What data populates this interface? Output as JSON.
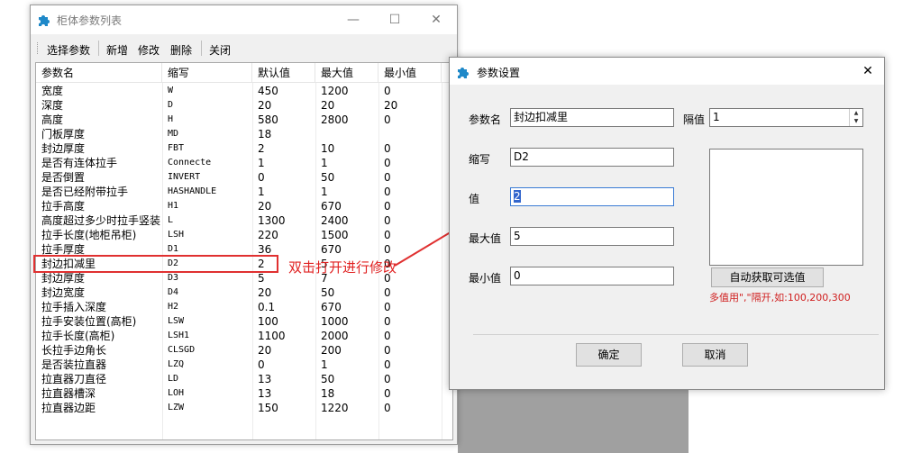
{
  "main_window": {
    "title": "柜体参数列表",
    "controls": {
      "minimize": "—",
      "maximize": "☐",
      "close": "✕"
    },
    "toolbar": [
      "选择参数",
      "新增",
      "修改",
      "删除",
      "关闭"
    ],
    "columns": [
      "参数名",
      "缩写",
      "默认值",
      "最大值",
      "最小值"
    ],
    "rows": [
      [
        "宽度",
        "W",
        "450",
        "1200",
        "0"
      ],
      [
        "深度",
        "D",
        "20",
        "20",
        "20"
      ],
      [
        "高度",
        "H",
        "580",
        "2800",
        "0"
      ],
      [
        "门板厚度",
        "MD",
        "18",
        "",
        ""
      ],
      [
        "封边厚度",
        "FBT",
        "2",
        "10",
        "0"
      ],
      [
        "是否有连体拉手",
        "Connecte",
        "1",
        "1",
        "0"
      ],
      [
        "是否倒置",
        "INVERT",
        "0",
        "50",
        "0"
      ],
      [
        "是否已经附带拉手",
        "HASHANDLE",
        "1",
        "1",
        "0"
      ],
      [
        "拉手高度",
        "H1",
        "20",
        "670",
        "0"
      ],
      [
        "高度超过多少时拉手竖装",
        "L",
        "1300",
        "2400",
        "0"
      ],
      [
        "拉手长度(地柜吊柜)",
        "LSH",
        "220",
        "1500",
        "0"
      ],
      [
        "拉手厚度",
        "D1",
        "36",
        "670",
        "0"
      ],
      [
        "封边扣减里",
        "D2",
        "2",
        "5",
        "0"
      ],
      [
        "封边厚度",
        "D3",
        "5",
        "7",
        "0"
      ],
      [
        "封边宽度",
        "D4",
        "20",
        "50",
        "0"
      ],
      [
        "拉手插入深度",
        "H2",
        "0.1",
        "670",
        "0"
      ],
      [
        "拉手安装位置(高柜)",
        "LSW",
        "100",
        "1000",
        "0"
      ],
      [
        "拉手长度(高柜)",
        "LSH1",
        "1100",
        "2000",
        "0"
      ],
      [
        "长拉手边角长",
        "CLSGD",
        "20",
        "200",
        "0"
      ],
      [
        "是否装拉直器",
        "LZQ",
        "0",
        "1",
        "0"
      ],
      [
        "拉直器刀直径",
        "LD",
        "13",
        "50",
        "0"
      ],
      [
        "拉直器槽深",
        "LOH",
        "13",
        "18",
        "0"
      ],
      [
        "拉直器边距",
        "LZW",
        "150",
        "1220",
        "0"
      ]
    ],
    "highlight_color": "#e03030"
  },
  "annotation": {
    "text": "双击打开进行修改",
    "color": "#e02020"
  },
  "dialog": {
    "title": "参数设置",
    "close": "✕",
    "labels": {
      "name": "参数名",
      "abbr": "缩写",
      "value": "值",
      "max": "最大值",
      "min": "最小值",
      "interval": "隔值"
    },
    "values": {
      "name": "封边扣减里",
      "abbr": "D2",
      "value": "2",
      "max": "5",
      "min": "0",
      "interval": "1"
    },
    "auto_button": "自动获取可选值",
    "hint": "多值用\",\"隔开,如:100,200,300",
    "ok": "确定",
    "cancel": "取消"
  }
}
